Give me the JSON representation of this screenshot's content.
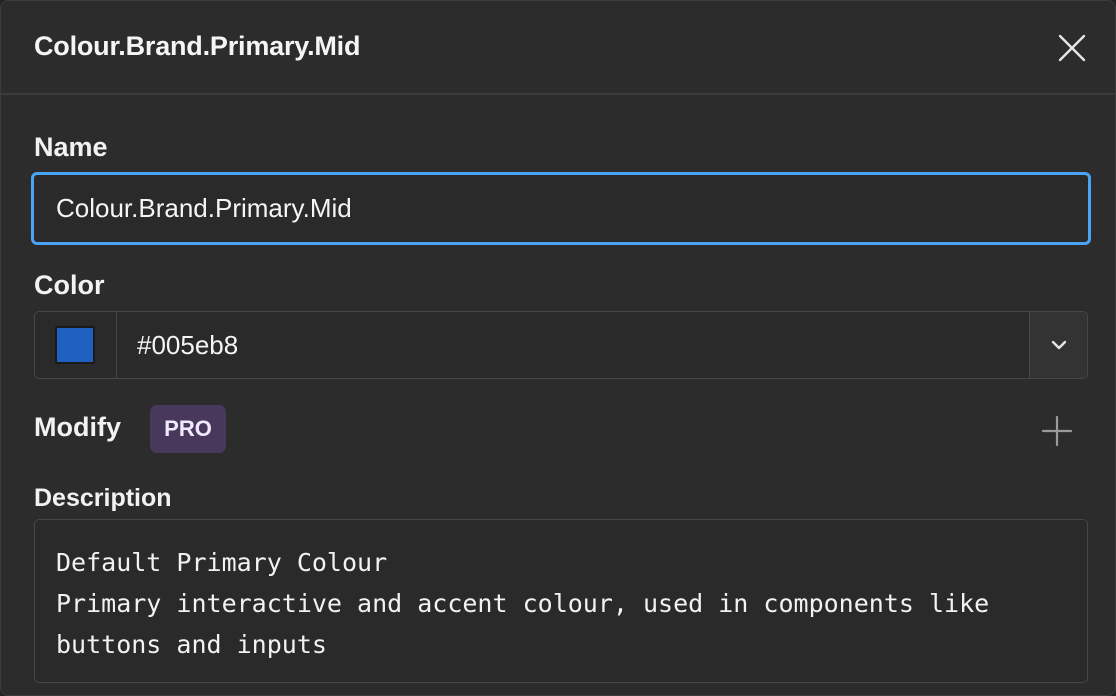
{
  "header": {
    "title": "Colour.Brand.Primary.Mid"
  },
  "name_field": {
    "label": "Name",
    "value": "Colour.Brand.Primary.Mid"
  },
  "color_field": {
    "label": "Color",
    "hex": "#005eb8",
    "swatch_color": "#1f5fbf"
  },
  "modify": {
    "label": "Modify",
    "badge": "PRO"
  },
  "description": {
    "label": "Description",
    "lines": [
      "Default Primary Colour",
      "Primary interactive and accent colour, used in components like",
      "buttons and inputs"
    ]
  },
  "icons": {
    "close": "close-icon",
    "dropdown": "chevron-down-icon",
    "add": "plus-icon"
  },
  "colors": {
    "focus_ring": "#4aa3f5",
    "pro_badge_bg": "#48395c",
    "panel_bg": "#2c2c2c"
  }
}
